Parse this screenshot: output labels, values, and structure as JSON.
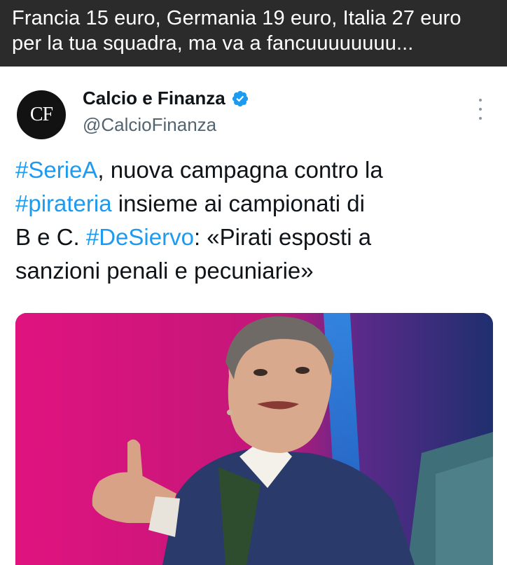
{
  "caption": {
    "line1": "Francia 15 euro, Germania 19 euro, Italia 27 euro",
    "line2": "per la tua squadra, ma va a fancuuuuuuuu..."
  },
  "tweet": {
    "avatar_text": "CF",
    "author_name": "Calcio e Finanza",
    "author_handle": "@CalcioFinanza",
    "text": {
      "l1_tag": "#SerieA",
      "l1_rest": ", nuova campagna contro la",
      "l2_tag": "#pirateria",
      "l2_rest": " insieme ai campionati di",
      "l3_pre": "B e C. ",
      "l3_tag": "#DeSiervo",
      "l3_rest": ": «Pirati esposti a",
      "l4": "sanzioni penali e pecuniarie»"
    },
    "media": {
      "description_icon": "photo-of-speaker"
    }
  },
  "colors": {
    "caption_bg": "#2b2b2b",
    "hashtag": "#1d9bf0",
    "verified": "#1d9bf0",
    "handle": "#536471",
    "media_bg": "#d8157e"
  }
}
